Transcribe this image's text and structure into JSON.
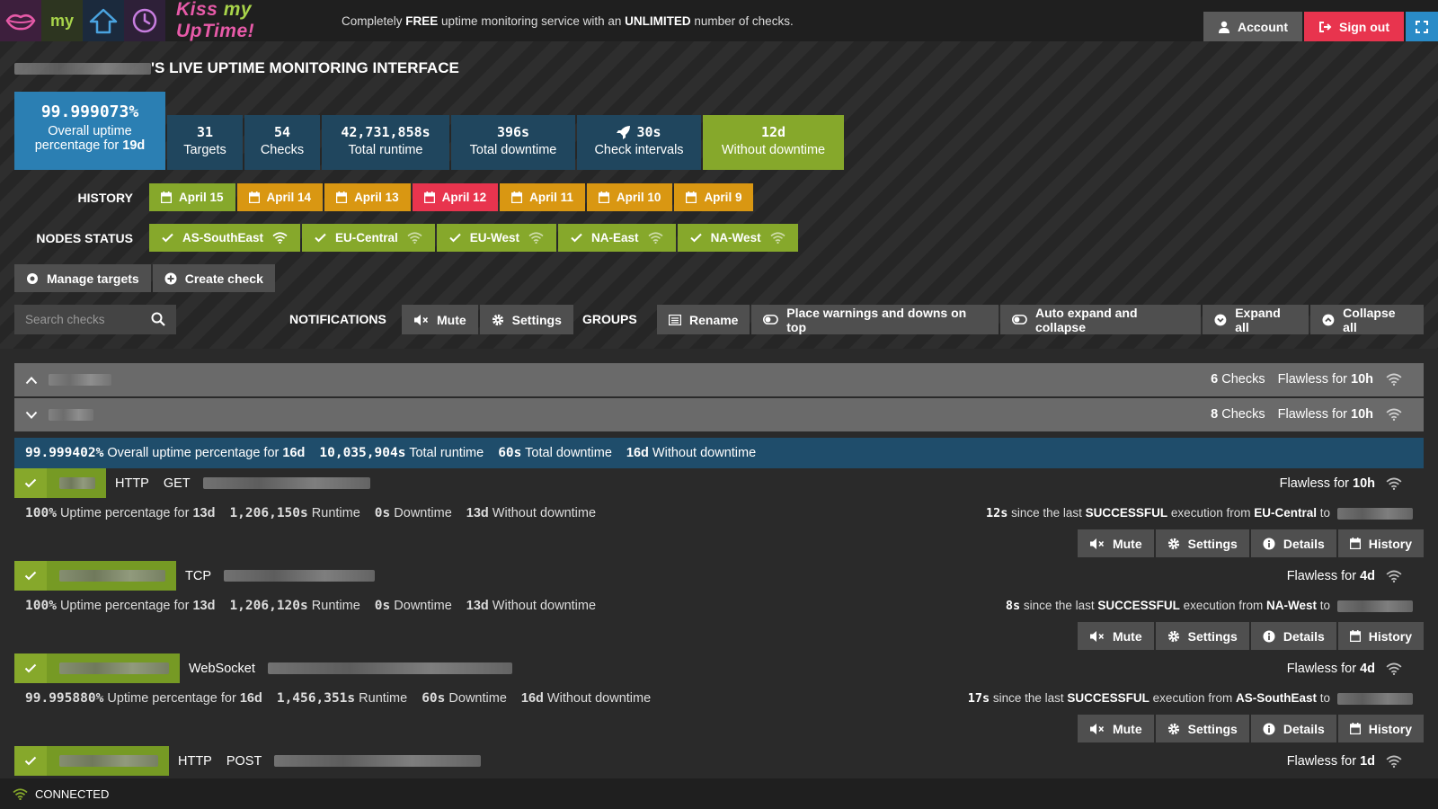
{
  "header": {
    "brand": "Kiss my UpTime!",
    "brand_pre": "Kiss ",
    "brand_my": "my",
    "brand_post": " UpTime!",
    "tagline_1": "Completely ",
    "tagline_free": "FREE",
    "tagline_2": " uptime monitoring service with an ",
    "tagline_unlimited": "UNLIMITED",
    "tagline_3": " number of checks.",
    "account_label": "Account",
    "signout_label": "Sign out"
  },
  "page": {
    "title_suffix": "'S LIVE UPTIME MONITORING INTERFACE"
  },
  "stats": [
    {
      "value": "99.999073%",
      "label": "Overall uptime",
      "label2_pre": "percentage for ",
      "label2_b": "19d"
    },
    {
      "value": "31",
      "label": "Targets"
    },
    {
      "value": "54",
      "label": "Checks"
    },
    {
      "value": "42,731,858s",
      "label": "Total runtime"
    },
    {
      "value": "396s",
      "label": "Total downtime"
    },
    {
      "value": "30s",
      "label": "Check intervals"
    },
    {
      "value": "12d",
      "label": "Without downtime"
    }
  ],
  "history": {
    "label": "HISTORY",
    "days": [
      "April 15",
      "April 14",
      "April 13",
      "April 12",
      "April 11",
      "April 10",
      "April 9"
    ]
  },
  "nodes": {
    "label": "NODES STATUS",
    "items": [
      "AS-SouthEast",
      "EU-Central",
      "EU-West",
      "NA-East",
      "NA-West"
    ]
  },
  "management": {
    "manage_targets": "Manage targets",
    "create_check": "Create check"
  },
  "toolbar": {
    "search_placeholder": "Search checks",
    "notifications_label": "NOTIFICATIONS",
    "mute": "Mute",
    "settings": "Settings",
    "groups_label": "GROUPS",
    "rename": "Rename",
    "warnings_top": "Place warnings and downs on top",
    "auto_expand": "Auto expand and collapse",
    "expand_all": "Expand all",
    "collapse_all": "Collapse all"
  },
  "groups": [
    {
      "checks_count": "6",
      "checks_label": "Checks",
      "flawless_pre": "Flawless for ",
      "flawless_value": "10h"
    },
    {
      "checks_count": "8",
      "checks_label": "Checks",
      "flawless_pre": "Flawless for ",
      "flawless_value": "10h"
    }
  ],
  "group_summary": {
    "uptime_value": "99.999402%",
    "uptime_label_pre": " Overall uptime percentage for ",
    "uptime_days": "16d",
    "runtime_value": "10,035,904s",
    "runtime_label": " Total runtime",
    "downtime_value": "60s",
    "downtime_label": " Total downtime",
    "wd_value": "16d",
    "wd_label": " Without downtime"
  },
  "checks": [
    {
      "protocol": "HTTP",
      "method": "GET",
      "flawless_pre": "Flawless for ",
      "flawless_value": "10h",
      "uptime_value": "100%",
      "uptime_label": " Uptime percentage for ",
      "uptime_days": "13d",
      "runtime_value": "1,206,150s",
      "runtime_label": " Runtime",
      "downtime_value": "0s",
      "downtime_label": " Downtime",
      "wd_value": "13d",
      "wd_label": " Without downtime",
      "exec_seconds": "12s",
      "exec_text_1": " since the last ",
      "exec_status": "SUCCESSFUL",
      "exec_text_2": " execution from ",
      "exec_node": "EU-Central",
      "exec_text_3": " to"
    },
    {
      "protocol": "TCP",
      "method": "",
      "flawless_pre": "Flawless for ",
      "flawless_value": "4d",
      "uptime_value": "100%",
      "uptime_label": " Uptime percentage for ",
      "uptime_days": "13d",
      "runtime_value": "1,206,120s",
      "runtime_label": " Runtime",
      "downtime_value": "0s",
      "downtime_label": " Downtime",
      "wd_value": "13d",
      "wd_label": " Without downtime",
      "exec_seconds": "8s",
      "exec_text_1": " since the last ",
      "exec_status": "SUCCESSFUL",
      "exec_text_2": " execution from ",
      "exec_node": "NA-West",
      "exec_text_3": " to"
    },
    {
      "protocol": "WebSocket",
      "method": "",
      "flawless_pre": "Flawless for ",
      "flawless_value": "4d",
      "uptime_value": "99.995880%",
      "uptime_label": " Uptime percentage for ",
      "uptime_days": "16d",
      "runtime_value": "1,456,351s",
      "runtime_label": " Runtime",
      "downtime_value": "60s",
      "downtime_label": " Downtime",
      "wd_value": "16d",
      "wd_label": " Without downtime",
      "exec_seconds": "17s",
      "exec_text_1": " since the last ",
      "exec_status": "SUCCESSFUL",
      "exec_text_2": " execution from ",
      "exec_node": "AS-SouthEast",
      "exec_text_3": " to"
    },
    {
      "protocol": "HTTP",
      "method": "POST",
      "flawless_pre": "Flawless for ",
      "flawless_value": "1d"
    }
  ],
  "check_buttons": {
    "mute": "Mute",
    "settings": "Settings",
    "details": "Details",
    "history": "History"
  },
  "status": {
    "label": "CONNECTED"
  }
}
